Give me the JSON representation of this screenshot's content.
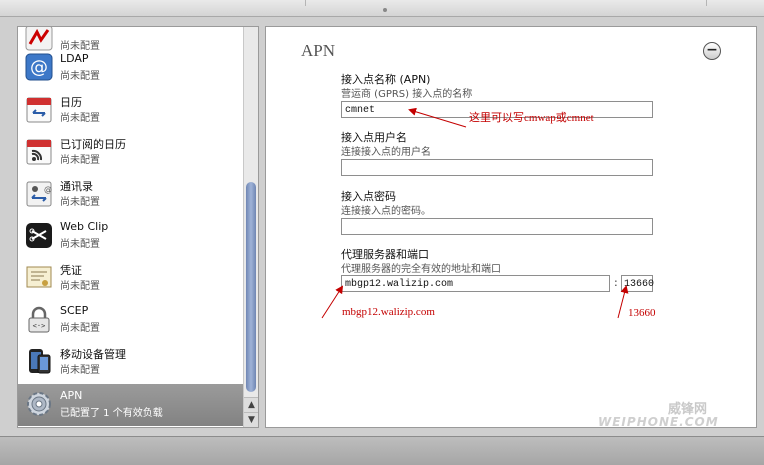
{
  "sidebar": {
    "items": [
      {
        "title": "",
        "subtitle": "尚未配置",
        "icon": "restriction-icon"
      },
      {
        "title": "LDAP",
        "subtitle": "尚未配置",
        "icon": "at-sign-icon"
      },
      {
        "title": "日历",
        "subtitle": "尚未配置",
        "icon": "calendar-icon"
      },
      {
        "title": "已订阅的日历",
        "subtitle": "尚未配置",
        "icon": "subscribed-calendar-icon"
      },
      {
        "title": "通讯录",
        "subtitle": "尚未配置",
        "icon": "contacts-icon"
      },
      {
        "title": "Web Clip",
        "subtitle": "尚未配置",
        "icon": "web-clip-icon"
      },
      {
        "title": "凭证",
        "subtitle": "尚未配置",
        "icon": "certificate-icon"
      },
      {
        "title": "SCEP",
        "subtitle": "尚未配置",
        "icon": "lock-icon"
      },
      {
        "title": "移动设备管理",
        "subtitle": "尚未配置",
        "icon": "device-management-icon"
      },
      {
        "title": "APN",
        "subtitle": "已配置了 1 个有效负载",
        "icon": "gear-icon"
      }
    ],
    "selected_index": 9
  },
  "panel": {
    "title": "APN",
    "collapse_symbol": "−",
    "apn_name_label": "接入点名称 (APN)",
    "apn_name_hint": "营运商 (GPRS) 接入点的名称",
    "apn_name_value": "cmnet",
    "user_label": "接入点用户名",
    "user_hint": "连接接入点的用户名",
    "user_value": "",
    "password_label": "接入点密码",
    "password_hint": "连接接入点的密码。",
    "password_value": "",
    "proxy_label": "代理服务器和端口",
    "proxy_hint": "代理服务器的完全有效的地址和端口",
    "proxy_value": "mbgp12.walizip.com",
    "port_separator": ":",
    "port_value": "13660"
  },
  "annotations": {
    "apn_note": "这里可以写cmwap或cmnet",
    "proxy_note": "mbgp12.walizip.com",
    "port_note": "13660",
    "color": "#c40000"
  },
  "watermark": {
    "line1": "威锋网",
    "line2": "WEIPHONE.COM"
  },
  "colors": {
    "selected_row": "#8e8e8e",
    "scroll_thumb": "#8ea2c9"
  }
}
